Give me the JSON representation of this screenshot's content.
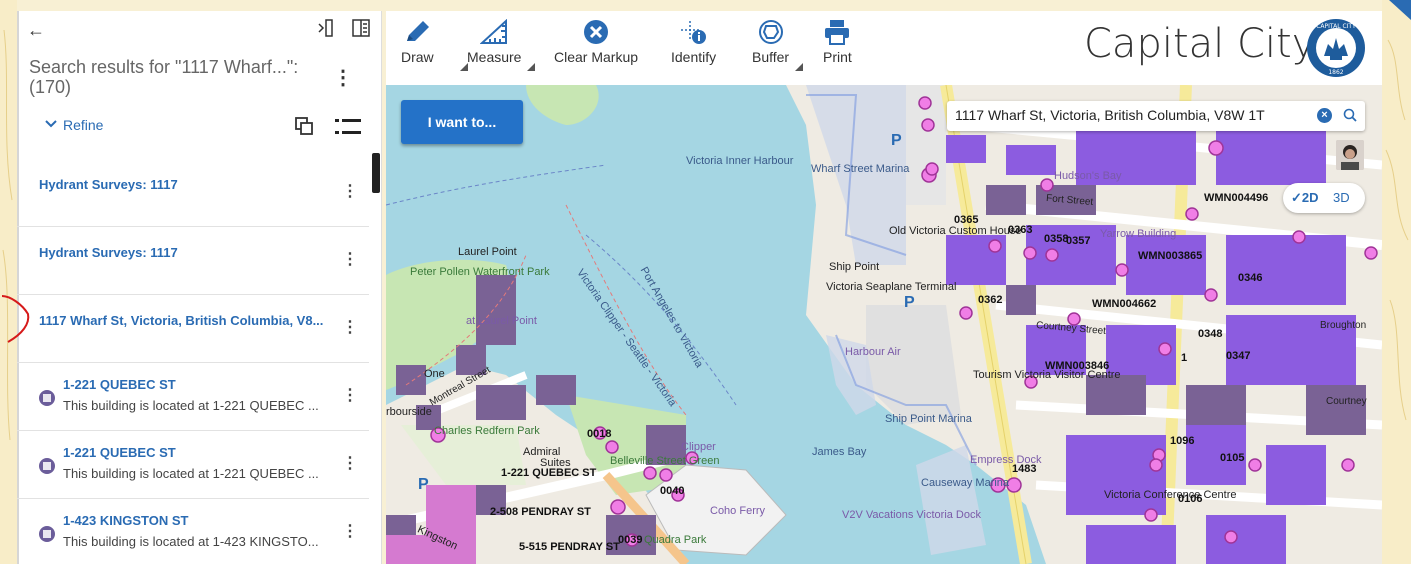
{
  "panel": {
    "back_label": "←",
    "search_title": "Search results for \"1117 Wharf...\": (170)",
    "refine_label": "Refine",
    "results": [
      {
        "title": "Hydrant Surveys: 1117",
        "desc": ""
      },
      {
        "title": "Hydrant Surveys: 1117",
        "desc": ""
      },
      {
        "title": "1117 Wharf St, Victoria, British Columbia, V8...",
        "desc": ""
      },
      {
        "title": "1-221 QUEBEC ST",
        "desc": "This building is located at 1-221 QUEBEC ..."
      },
      {
        "title": "1-221 QUEBEC ST",
        "desc": "This building is located at 1-221 QUEBEC ..."
      },
      {
        "title": "1-423 KINGSTON ST",
        "desc": "This building is located at 1-423 KINGSTO..."
      }
    ]
  },
  "toolbar": {
    "tools": [
      "Draw",
      "Measure",
      "Clear Markup",
      "Identify",
      "Buffer",
      "Print"
    ],
    "app_title": "Capital City",
    "seal_text": "CAPITAL CITY",
    "seal_year": "1862"
  },
  "map": {
    "i_want_to": "I want to...",
    "search_value": "1117 Wharf St, Victoria, British Columbia, V8W 1T",
    "view_2d": "2D",
    "view_3d": "3D",
    "labels": {
      "victoria_inner_harbour": "Victoria Inner Harbour",
      "wharf_street_marina": "Wharf Street Marina",
      "laurel_point": "Laurel Point",
      "peter_pollen": "Peter Pollen Waterfront Park",
      "clipper": "Victoria Clipper - Seattle - Victoria",
      "port_angeles": "Port Angeles to Victoria",
      "ship_point": "Ship Point",
      "seaplane": "Victoria Seaplane Terminal",
      "harbour_air": "Harbour Air",
      "ship_point_marina": "Ship Point Marina",
      "james_bay": "James Bay",
      "causeway_marina": "Causeway Marina",
      "coho_ferry": "Coho Ferry",
      "v2v": "V2V Vacations Victoria Dock",
      "tourism": "Tourism Victoria Visitor Centre",
      "empress_dock": "Empress Dock",
      "conference": "Victoria Conference Centre",
      "charles_redfern": "Charles Redfern Park",
      "belleville": "Belleville Street Green",
      "quadra_park": "Quadra Park",
      "courtney": "Courtney Street",
      "fort_street": "Fort Street",
      "broughton": "Broughton",
      "montreal": "Montreal Street",
      "old_victoria": "Old Victoria Custom House",
      "hudsons_bay": "Hudson's Bay",
      "yarrow": "Yarrow Building",
      "victoria_clipper_dock": "Clipper",
      "admiral": "Admiral",
      "kingston": "Kingston",
      "harbourside": "rbourside",
      "laurel_point_park": "at Laurel Point",
      "suites": "Suites",
      "one": "One",
      "courtney2": "Courtney"
    },
    "codes": [
      "0365",
      "0363",
      "0358",
      "0357",
      "WMN004496",
      "WMN003865",
      "0346",
      "WMN004662",
      "0362",
      "0348",
      "0347",
      "WMN003846",
      "1096",
      "0105",
      "1483",
      "0106",
      "0018",
      "0040",
      "0039",
      "1-221 QUEBEC ST",
      "2-508 PENDRAY ST",
      "5-515 PENDRAY ST",
      "1"
    ]
  }
}
